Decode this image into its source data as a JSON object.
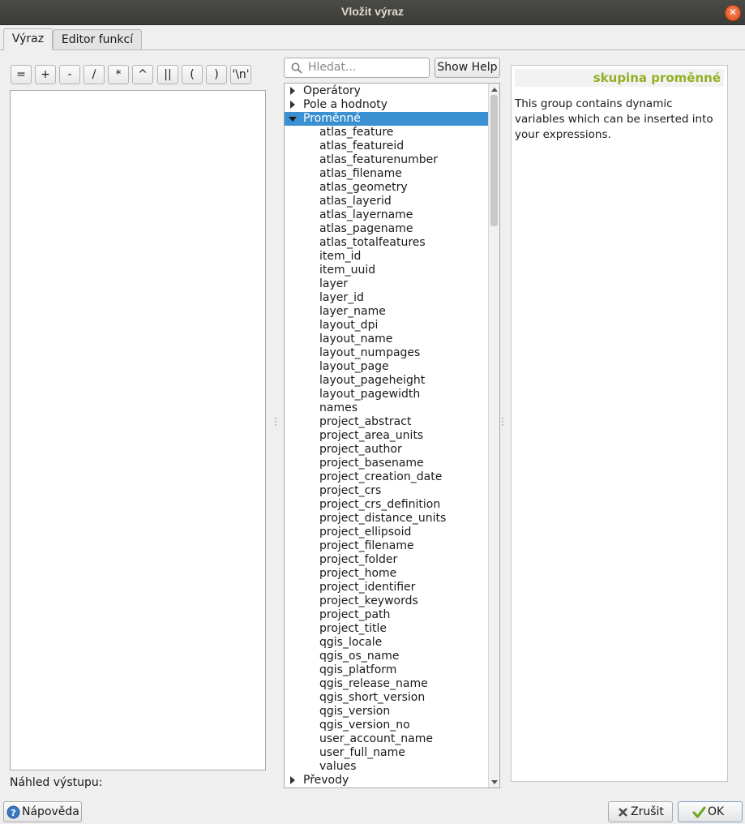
{
  "window": {
    "title": "Vložit výraz"
  },
  "tabs": [
    {
      "label": "Výraz",
      "active": true
    },
    {
      "label": "Editor funkcí",
      "active": false
    }
  ],
  "operators": [
    "=",
    "+",
    "-",
    "/",
    "*",
    "^",
    "||",
    "(",
    ")",
    "'\\n'"
  ],
  "preview_label": "Náhled výstupu:",
  "search": {
    "placeholder": "Hledat..."
  },
  "show_help_label": "Show Help",
  "tree": {
    "groups_before": [
      "Operátory",
      "Pole a hodnoty"
    ],
    "expanded_group": "Proměnné",
    "variables": [
      "atlas_feature",
      "atlas_featureid",
      "atlas_featurenumber",
      "atlas_filename",
      "atlas_geometry",
      "atlas_layerid",
      "atlas_layername",
      "atlas_pagename",
      "atlas_totalfeatures",
      "item_id",
      "item_uuid",
      "layer",
      "layer_id",
      "layer_name",
      "layout_dpi",
      "layout_name",
      "layout_numpages",
      "layout_page",
      "layout_pageheight",
      "layout_pagewidth",
      "names",
      "project_abstract",
      "project_area_units",
      "project_author",
      "project_basename",
      "project_creation_date",
      "project_crs",
      "project_crs_definition",
      "project_distance_units",
      "project_ellipsoid",
      "project_filename",
      "project_folder",
      "project_home",
      "project_identifier",
      "project_keywords",
      "project_path",
      "project_title",
      "qgis_locale",
      "qgis_os_name",
      "qgis_platform",
      "qgis_release_name",
      "qgis_short_version",
      "qgis_version",
      "qgis_version_no",
      "user_account_name",
      "user_full_name",
      "values"
    ],
    "groups_after": [
      "Převody"
    ]
  },
  "help": {
    "heading": "skupina proměnné",
    "text": "This group contains dynamic variables which can be inserted into your expressions."
  },
  "buttons": {
    "help": "Nápověda",
    "cancel": "Zrušit",
    "ok": "OK"
  },
  "colors": {
    "selection": "#3a90d1",
    "help_heading": "#93b023",
    "titlebar": "#3c3b37"
  }
}
